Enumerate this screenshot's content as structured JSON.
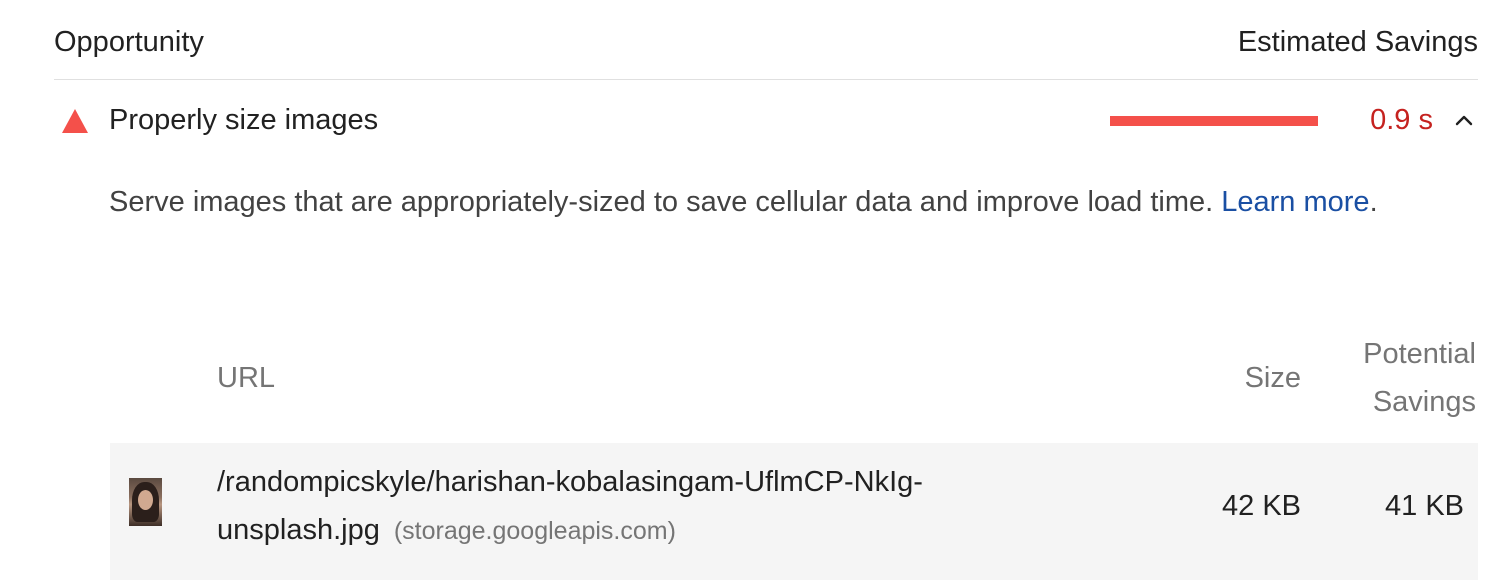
{
  "header": {
    "left_label": "Opportunity",
    "right_label": "Estimated Savings"
  },
  "audit": {
    "icon": "warning-triangle-icon",
    "title": "Properly size images",
    "savings_value": "0.9 s",
    "savings_fraction": 1.0,
    "status_color": "#f4504a",
    "value_color": "#c5221f",
    "expanded": true,
    "description": "Serve images that are appropriately-sized to save cellular data and improve load time.",
    "learn_more_link": "Learn more",
    "description_end": "."
  },
  "table": {
    "headers": {
      "url": "URL",
      "size": "Size",
      "savings_line1": "Potential",
      "savings_line2": "Savings"
    },
    "rows": [
      {
        "url_path": "/randompicskyle/harishan-kobalasingam-UflmCP-NkIg-unsplash.jpg",
        "host": "(storage.googleapis.com)",
        "size": "42 KB",
        "savings": "41 KB"
      }
    ]
  }
}
